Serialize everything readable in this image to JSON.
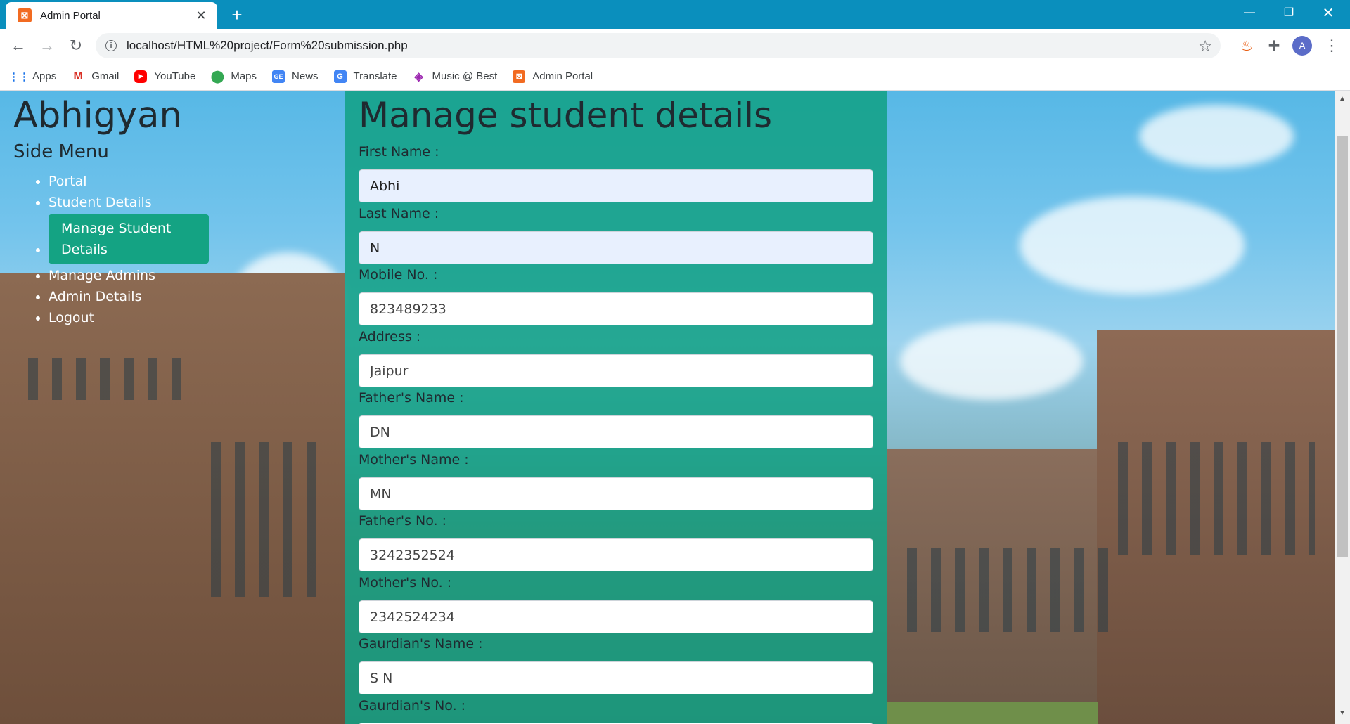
{
  "browser": {
    "tab_title": "Admin Portal",
    "tab_favicon": "xampp-icon",
    "url": "localhost/HTML%20project/Form%20submission.php",
    "avatar_letter": "A"
  },
  "bookmarks": [
    {
      "label": "Apps",
      "icon": "apps-grid-icon"
    },
    {
      "label": "Gmail",
      "icon": "gmail-icon"
    },
    {
      "label": "YouTube",
      "icon": "youtube-icon"
    },
    {
      "label": "Maps",
      "icon": "maps-pin-icon"
    },
    {
      "label": "News",
      "icon": "news-icon"
    },
    {
      "label": "Translate",
      "icon": "translate-icon"
    },
    {
      "label": "Music @ Best",
      "icon": "music-icon"
    },
    {
      "label": "Admin Portal",
      "icon": "xampp-icon"
    }
  ],
  "sidebar": {
    "brand": "Abhigyan",
    "title": "Side Menu",
    "items": [
      {
        "label": "Portal",
        "active": false
      },
      {
        "label": "Student Details",
        "active": false
      },
      {
        "label": "Manage Student Details",
        "active": true
      },
      {
        "label": "Manage Admins",
        "active": false
      },
      {
        "label": "Admin Details",
        "active": false
      },
      {
        "label": "Logout",
        "active": false
      }
    ],
    "active_color": "#14a383"
  },
  "form": {
    "title": "Manage student details",
    "fields": [
      {
        "label": "First Name :",
        "value": "Abhi"
      },
      {
        "label": "Last Name :",
        "value": "N"
      },
      {
        "label": "Mobile No. :",
        "value": "823489233"
      },
      {
        "label": "Address :",
        "value": "Jaipur"
      },
      {
        "label": "Father's Name :",
        "value": "DN"
      },
      {
        "label": "Mother's Name :",
        "value": "MN"
      },
      {
        "label": "Father's No. :",
        "value": "3242352524"
      },
      {
        "label": "Mother's No. :",
        "value": "2342524234"
      },
      {
        "label": "Gaurdian's Name :",
        "value": "S N"
      },
      {
        "label": "Gaurdian's No. :",
        "value": ""
      }
    ],
    "panel_color": "#11a082"
  },
  "colors": {
    "titlebar": "#0a8fbd"
  }
}
